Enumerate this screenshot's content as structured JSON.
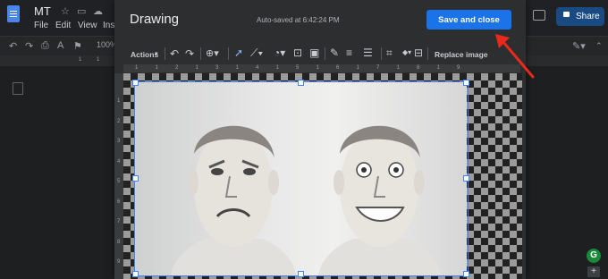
{
  "docs": {
    "title": "MT",
    "menus": [
      "File",
      "Edit",
      "View",
      "Inse"
    ],
    "share_label": "Share",
    "zoom": "100%",
    "ruler_marks": [
      "1",
      "1"
    ]
  },
  "dialog": {
    "title": "Drawing",
    "autosave": "Auto-saved at 6:42:24 PM",
    "save_label": "Save and close"
  },
  "toolbar": {
    "actions_label": "Actions",
    "replace_label": "Replace image"
  },
  "ruler": {
    "top": [
      "1",
      "1",
      "2",
      "1",
      "3",
      "1",
      "4",
      "1",
      "5",
      "1",
      "6",
      "1",
      "7",
      "1",
      "8",
      "1",
      "9"
    ],
    "left": [
      "1",
      "2",
      "3",
      "4",
      "5",
      "6",
      "7",
      "8",
      "9"
    ]
  },
  "colors": {
    "accent": "#1a73e8",
    "annotation": "#e8291c"
  }
}
